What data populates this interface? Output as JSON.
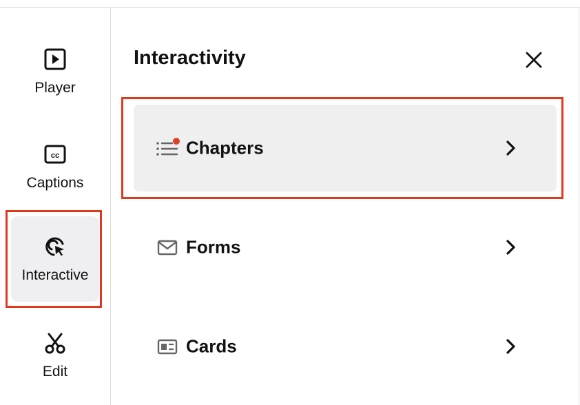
{
  "sidebar": {
    "items": [
      {
        "label": "Player",
        "icon": "play-icon",
        "active": false
      },
      {
        "label": "Captions",
        "icon": "cc-icon",
        "active": false
      },
      {
        "label": "Interactive",
        "icon": "interactive-cursor-icon",
        "active": true
      },
      {
        "label": "Edit",
        "icon": "scissors-icon",
        "active": false
      }
    ]
  },
  "panel": {
    "title": "Interactivity",
    "close_icon": "close-icon",
    "rows": [
      {
        "label": "Chapters",
        "icon": "list-icon",
        "has_notification_dot": true,
        "selected": true
      },
      {
        "label": "Forms",
        "icon": "envelope-icon",
        "has_notification_dot": false,
        "selected": false
      },
      {
        "label": "Cards",
        "icon": "card-icon",
        "has_notification_dot": false,
        "selected": false
      }
    ]
  },
  "colors": {
    "highlight": "#e2381d",
    "notification_dot": "#d9412a",
    "active_background": "#efeff1",
    "divider": "#dcdcdc"
  }
}
